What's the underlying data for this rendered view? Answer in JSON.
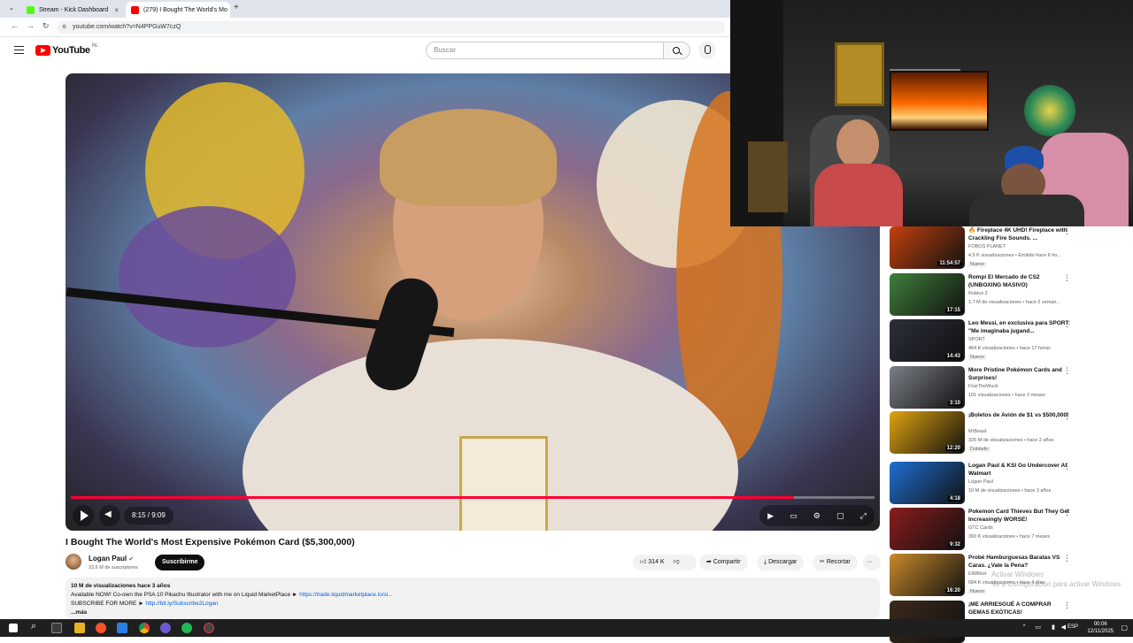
{
  "browser": {
    "tabs": [
      {
        "title": "Stream - Kick Dashboard",
        "icon": "kick-icon",
        "color": "#53fc18",
        "active": false
      },
      {
        "title": "(279) I Bought The World's Mo",
        "icon": "youtube-icon",
        "color": "#ff0000",
        "active": true
      }
    ],
    "new_tab_glyph": "+",
    "close_glyph": "×",
    "url": "youtube.com/watch?v=N4PPGuW7czQ"
  },
  "header": {
    "logo_text": "YouTube",
    "logo_region": "PE",
    "search_placeholder": "Buscar"
  },
  "player": {
    "current_time": "8:15",
    "duration": "9:09",
    "time_display": "8:15 / 9:09",
    "progress": 0.9
  },
  "video": {
    "title": "I Bought The World's Most Expensive Pokémon Card ($5,300,000)",
    "channel": "Logan Paul",
    "subscribers": "23,6 M de suscriptores",
    "subscribe_label": "Suscribirme",
    "likes": "314 K",
    "share_label": "Compartir",
    "download_label": "Descargar",
    "clip_label": "Recortar",
    "more_glyph": "···"
  },
  "description": {
    "stats": "10 M de visualizaciones  hace 3 años",
    "line1_text": "Available NOW! Co-own the PSA 10 Pikachu Illustrator with me on Liquid MarketPlace ►",
    "line1_link": "https://trade.liquidmarketplace.io/si...",
    "line2_text": "SUBSCRIBE FOR MORE ►",
    "line2_link": "http://bit.ly/Subscribe2Logan",
    "more": "...más"
  },
  "recommendations": [
    {
      "title": "🔥 Fireplace 4K UHD! Fireplace with Crackling Fire Sounds. ...",
      "channel": "FOBOS PLANET",
      "meta": "4,5 K visualizaciones • Emitido hace 6 ho...",
      "badge": "Nuevo",
      "duration": "11:54:57",
      "color": "#c2410c"
    },
    {
      "title": "Rompi El Mercado de CS2 (UNBOXING MASIVO)",
      "channel": "Rubius Z",
      "meta": "1,7 M de visualizaciones • hace 2 seman...",
      "badge": "",
      "duration": "17:15",
      "color": "#3f7f3a"
    },
    {
      "title": "Leo Messi, en exclusiva para SPORT: \"Me imaginaba jugand...",
      "channel": "SPORT",
      "meta": "484 K visualizaciones • hace 17 horas",
      "badge": "Nuevo",
      "duration": "14:43",
      "color": "#2a2f3a"
    },
    {
      "title": "More Pristine Pokémon Cards and Surprises!",
      "channel": "FlueTheWuck",
      "meta": "101 visualizaciones • hace 2 meses",
      "badge": "",
      "duration": "3:10",
      "color": "#7a7f86"
    },
    {
      "title": "¡Boletos de Avión de $1 vs $500,000!",
      "channel": "MrBeast",
      "meta": "325 M de visualizaciones • hace 2 años",
      "badge": "Doblado",
      "duration": "12:20",
      "color": "#e0a30f"
    },
    {
      "title": "Logan Paul & KSI Go Undercover At Walmart",
      "channel": "Logan Paul",
      "meta": "10 M de visualizaciones • hace 3 años",
      "badge": "",
      "duration": "4:18",
      "color": "#1f6fd1"
    },
    {
      "title": "Pokemon Card Thieves But They Get Increasingly WORSE!",
      "channel": "GTC Cards",
      "meta": "360 K visualizaciones • hace 7 meses",
      "badge": "",
      "duration": "9:32",
      "color": "#8a1c1c"
    },
    {
      "title": "Probé Hamburguesas Baratas VS Caras. ¿Vale la Pena?",
      "channel": "ElWilbur",
      "meta": "684 K visualizaciones • hace 4 días",
      "badge": "Nuevo",
      "duration": "16:20",
      "color": "#c98a2a"
    },
    {
      "title": "¡ME ARRIESGUÉ A COMPRAR GEMAS EXÓTICAS!",
      "channel": "",
      "meta": "",
      "badge": "",
      "duration": "",
      "color": "#3c2a1a"
    }
  ],
  "taskbar": {
    "language": "ESP",
    "time": "00:06",
    "date": "12/11/2025"
  },
  "watermark": {
    "line1": "Activar Windows",
    "line2": "Ve a Configuración para activar Windows."
  }
}
